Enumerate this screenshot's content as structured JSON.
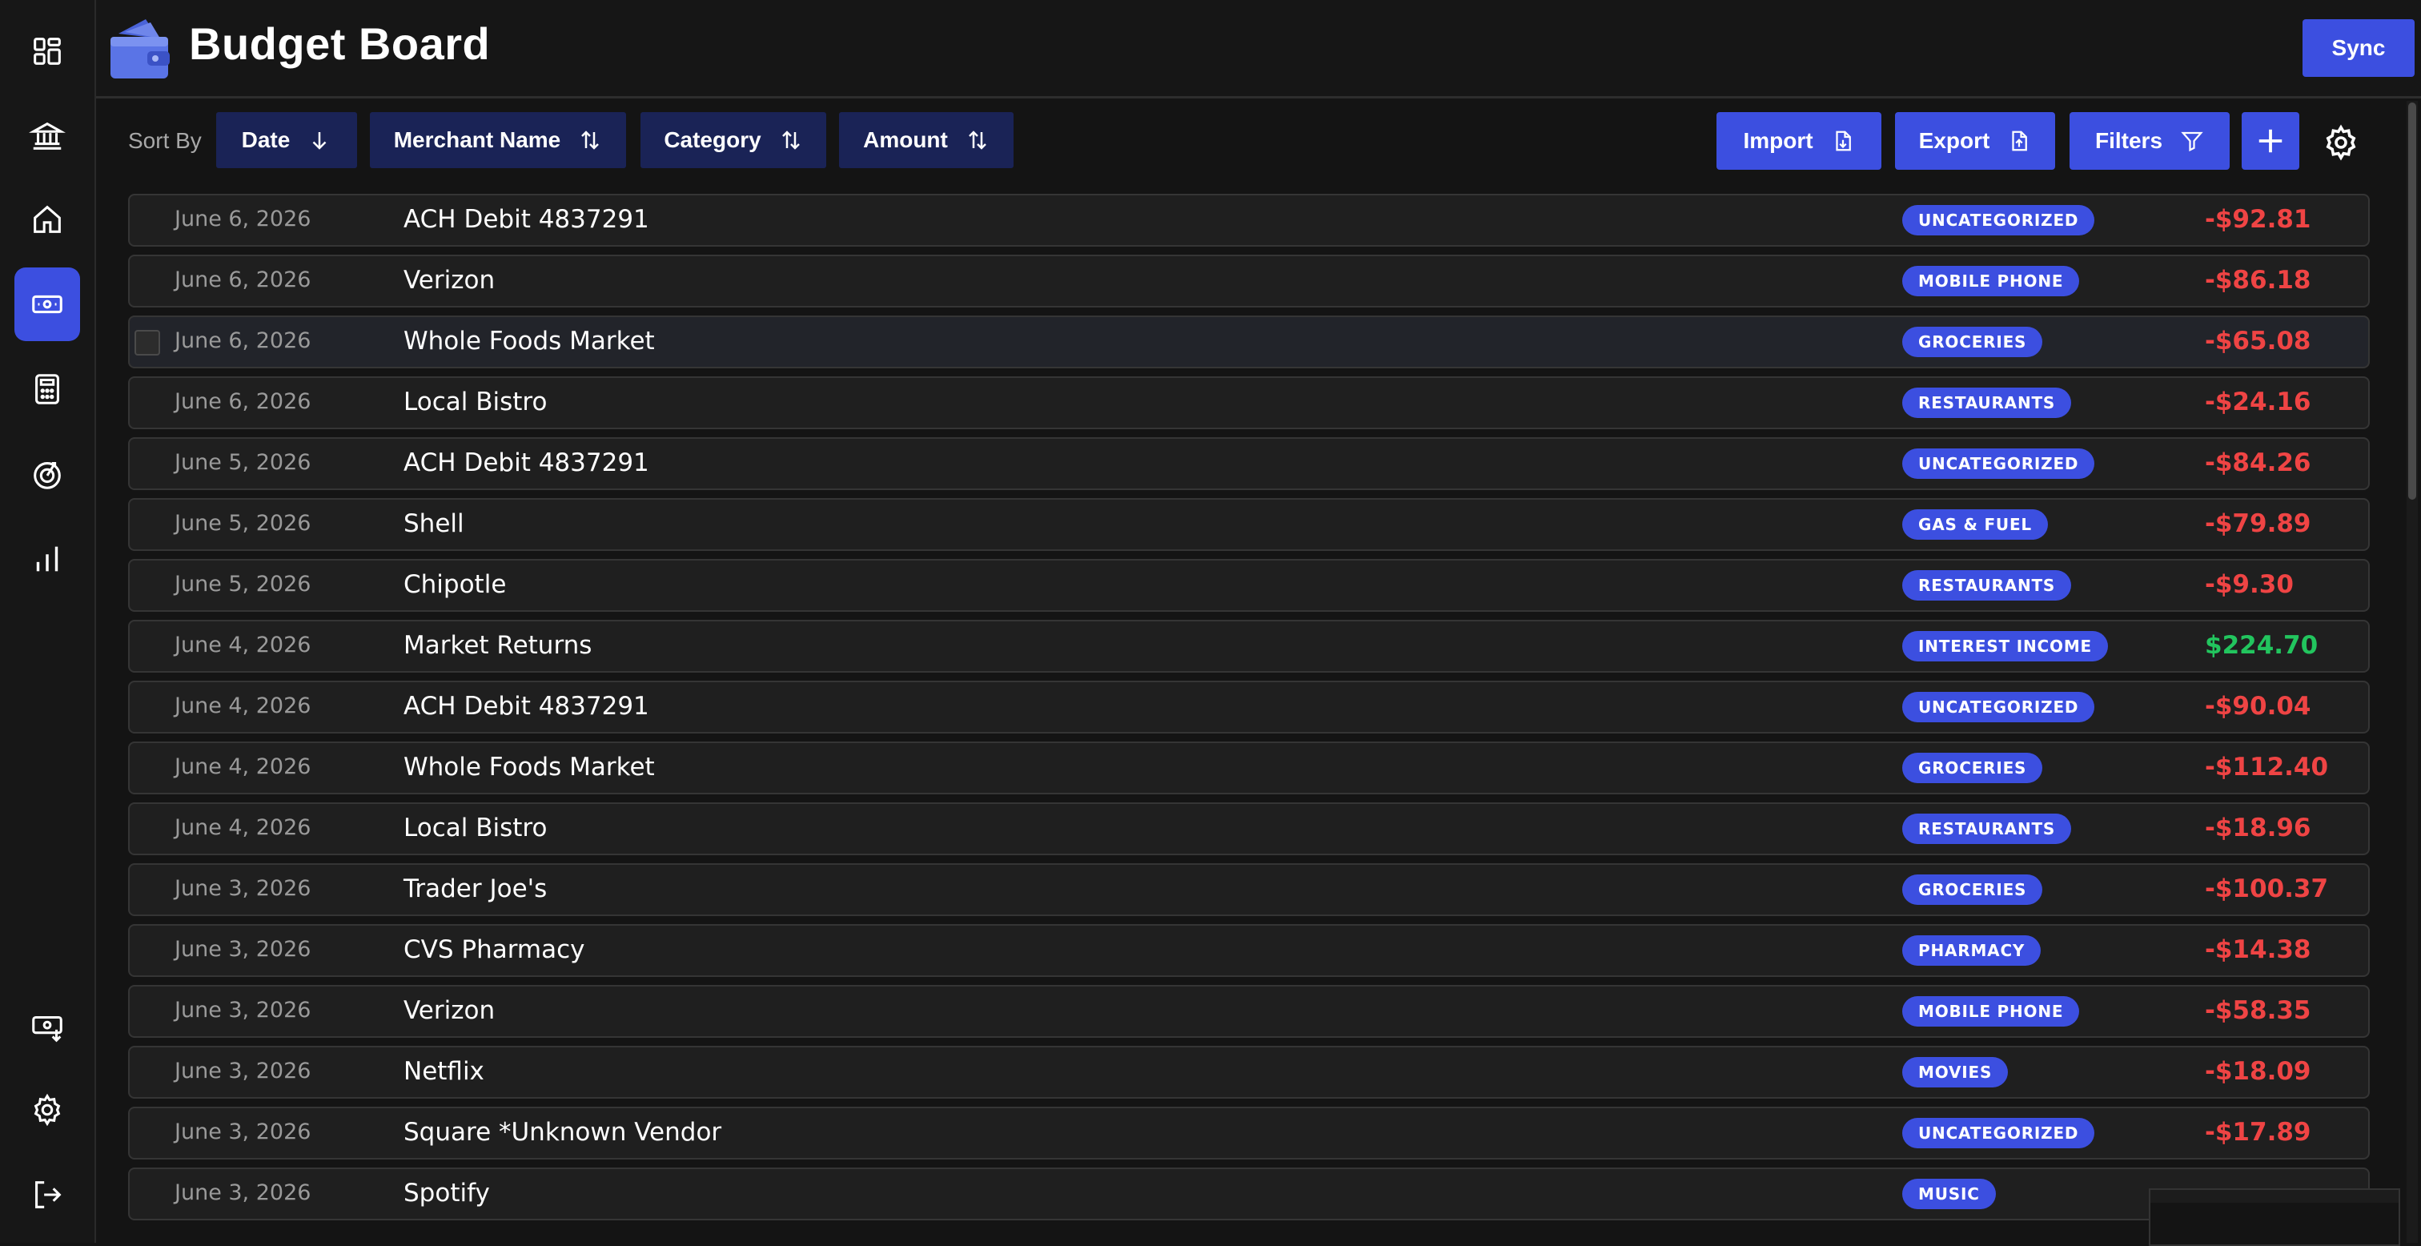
{
  "app": {
    "title": "Budget Board",
    "sync_label": "Sync"
  },
  "sidebar": {
    "items": [
      {
        "icon": "dashboard-icon"
      },
      {
        "icon": "bank-icon"
      },
      {
        "icon": "home-icon"
      },
      {
        "icon": "money-icon",
        "active": true
      },
      {
        "icon": "calculator-icon"
      },
      {
        "icon": "goal-icon"
      },
      {
        "icon": "chart-icon"
      }
    ],
    "bottom_items": [
      {
        "icon": "money-import-icon"
      },
      {
        "icon": "settings-icon"
      },
      {
        "icon": "logout-icon"
      }
    ]
  },
  "toolbar": {
    "sort_by_label": "Sort By",
    "sort_buttons": [
      {
        "label": "Date",
        "icon": "arrow-down-icon"
      },
      {
        "label": "Merchant Name",
        "icon": "sort-arrows-icon"
      },
      {
        "label": "Category",
        "icon": "sort-arrows-icon"
      },
      {
        "label": "Amount",
        "icon": "sort-arrows-icon"
      }
    ],
    "import_label": "Import",
    "export_label": "Export",
    "filters_label": "Filters"
  },
  "colors": {
    "accent": "#3c4fe0",
    "sort_button": "#1a2356",
    "negative": "#ef4444",
    "positive": "#22c55e"
  },
  "transactions": [
    {
      "date": "June 6, 2026",
      "merchant": "ACH Debit 4837291",
      "category": "UNCATEGORIZED",
      "amount": "-$92.81"
    },
    {
      "date": "June 6, 2026",
      "merchant": "Verizon",
      "category": "MOBILE PHONE",
      "amount": "-$86.18"
    },
    {
      "date": "June 6, 2026",
      "merchant": "Whole Foods Market",
      "category": "GROCERIES",
      "amount": "-$65.08"
    },
    {
      "date": "June 6, 2026",
      "merchant": "Local Bistro",
      "category": "RESTAURANTS",
      "amount": "-$24.16"
    },
    {
      "date": "June 5, 2026",
      "merchant": "ACH Debit 4837291",
      "category": "UNCATEGORIZED",
      "amount": "-$84.26"
    },
    {
      "date": "June 5, 2026",
      "merchant": "Shell",
      "category": "GAS & FUEL",
      "amount": "-$79.89"
    },
    {
      "date": "June 5, 2026",
      "merchant": "Chipotle",
      "category": "RESTAURANTS",
      "amount": "-$9.30"
    },
    {
      "date": "June 4, 2026",
      "merchant": "Market Returns",
      "category": "INTEREST INCOME",
      "amount": "$224.70"
    },
    {
      "date": "June 4, 2026",
      "merchant": "ACH Debit 4837291",
      "category": "UNCATEGORIZED",
      "amount": "-$90.04"
    },
    {
      "date": "June 4, 2026",
      "merchant": "Whole Foods Market",
      "category": "GROCERIES",
      "amount": "-$112.40"
    },
    {
      "date": "June 4, 2026",
      "merchant": "Local Bistro",
      "category": "RESTAURANTS",
      "amount": "-$18.96"
    },
    {
      "date": "June 3, 2026",
      "merchant": "Trader Joe's",
      "category": "GROCERIES",
      "amount": "-$100.37"
    },
    {
      "date": "June 3, 2026",
      "merchant": "CVS Pharmacy",
      "category": "PHARMACY",
      "amount": "-$14.38"
    },
    {
      "date": "June 3, 2026",
      "merchant": "Verizon",
      "category": "MOBILE PHONE",
      "amount": "-$58.35"
    },
    {
      "date": "June 3, 2026",
      "merchant": "Netflix",
      "category": "MOVIES",
      "amount": "-$18.09"
    },
    {
      "date": "June 3, 2026",
      "merchant": "Square *Unknown Vendor",
      "category": "UNCATEGORIZED",
      "amount": "-$17.89"
    },
    {
      "date": "June 3, 2026",
      "merchant": "Spotify",
      "category": "MUSIC",
      "amount": ""
    }
  ]
}
